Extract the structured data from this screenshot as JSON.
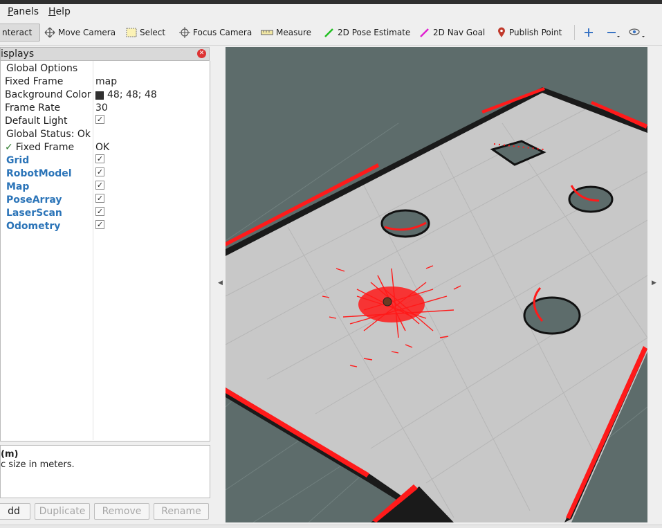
{
  "menu": {
    "panels": "Panels",
    "panels_mnemonic": "P",
    "panels_rest": "anels",
    "help": "Help",
    "help_mnemonic": "H",
    "help_rest": "elp"
  },
  "toolbar": {
    "interact": "nteract",
    "move_camera": "Move Camera",
    "select": "Select",
    "focus_camera": "Focus Camera",
    "measure": "Measure",
    "pose_estimate": "2D Pose Estimate",
    "nav_goal": "2D Nav Goal",
    "publish_point": "Publish Point"
  },
  "displays": {
    "title": "isplays",
    "global_options": "Global Options",
    "fixed_frame_label": "Fixed Frame",
    "fixed_frame_value": "map",
    "bg_color_label": "Background Color",
    "bg_color_value": "48; 48; 48",
    "frame_rate_label": "Frame Rate",
    "frame_rate_value": "30",
    "default_light_label": "Default Light",
    "global_status": "Global Status: Ok",
    "status_fixed_frame_label": "Fixed Frame",
    "status_fixed_frame_value": "OK",
    "items": [
      {
        "label": "Grid",
        "checked": true
      },
      {
        "label": "RobotModel",
        "checked": true
      },
      {
        "label": "Map",
        "checked": true
      },
      {
        "label": "PoseArray",
        "checked": true
      },
      {
        "label": "LaserScan",
        "checked": true
      },
      {
        "label": "Odometry",
        "checked": true
      }
    ]
  },
  "description": {
    "title": "(m)",
    "text": "c size in meters."
  },
  "buttons": {
    "add": "dd",
    "duplicate": "Duplicate",
    "remove": "Remove",
    "rename": "Rename"
  },
  "colors": {
    "viewport_bg": "#5d6c6b",
    "floor": "#c9c9c9",
    "laser": "#ff1a1a",
    "display_label": "#2b74b8"
  }
}
